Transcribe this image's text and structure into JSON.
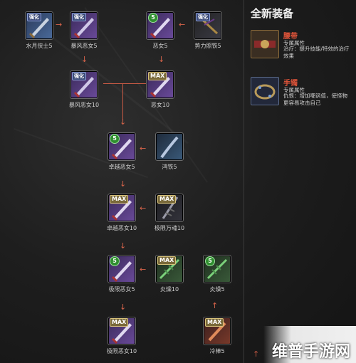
{
  "nodes": [
    {
      "key": "n1",
      "label": "水月侠士5",
      "badge": "",
      "theme": "blue"
    },
    {
      "key": "n2",
      "label": "暴风恶女5",
      "badge": "",
      "theme": "purple"
    },
    {
      "key": "n3",
      "label": "恶女5",
      "badge": "5",
      "theme": "purple"
    },
    {
      "key": "n4",
      "label": "势力照铁5",
      "badge": "",
      "theme": "dark"
    },
    {
      "key": "n5",
      "label": "暴风恶女10",
      "badge": "",
      "theme": "purple"
    },
    {
      "key": "n6",
      "label": "恶女10",
      "badge": "MAX",
      "theme": "purple"
    },
    {
      "key": "n7",
      "label": "卓越恶女5",
      "badge": "5",
      "theme": "purple"
    },
    {
      "key": "n8",
      "label": "鸿铁5",
      "badge": "",
      "theme": "blue"
    },
    {
      "key": "n9",
      "label": "卓越恶女10",
      "badge": "MAX",
      "theme": "purple"
    },
    {
      "key": "n10",
      "label": "极限万魂10",
      "badge": "MAX",
      "theme": "dark"
    },
    {
      "key": "n11",
      "label": "极限恶女5",
      "badge": "5",
      "theme": "purple"
    },
    {
      "key": "n12",
      "label": "炎燥10",
      "badge": "MAX",
      "theme": "green"
    },
    {
      "key": "n13",
      "label": "炎燥5",
      "badge": "5",
      "theme": "green"
    },
    {
      "key": "n14",
      "label": "极限恶女10",
      "badge": "MAX",
      "theme": "purple"
    },
    {
      "key": "n15",
      "label": "冷棒5",
      "badge": "MAX",
      "theme": "red"
    }
  ],
  "right_panel": {
    "title": "全新装备",
    "items": [
      {
        "name": "腰带",
        "type": "专属属性",
        "desc": "治疗：提升技能/特效的治疗效果"
      },
      {
        "name": "手镯",
        "type": "专属属性",
        "desc": "仇恨：增加嘲讽值，使怪物更容易攻击自己"
      }
    ]
  },
  "watermark": {
    "text": "维普手游网"
  }
}
